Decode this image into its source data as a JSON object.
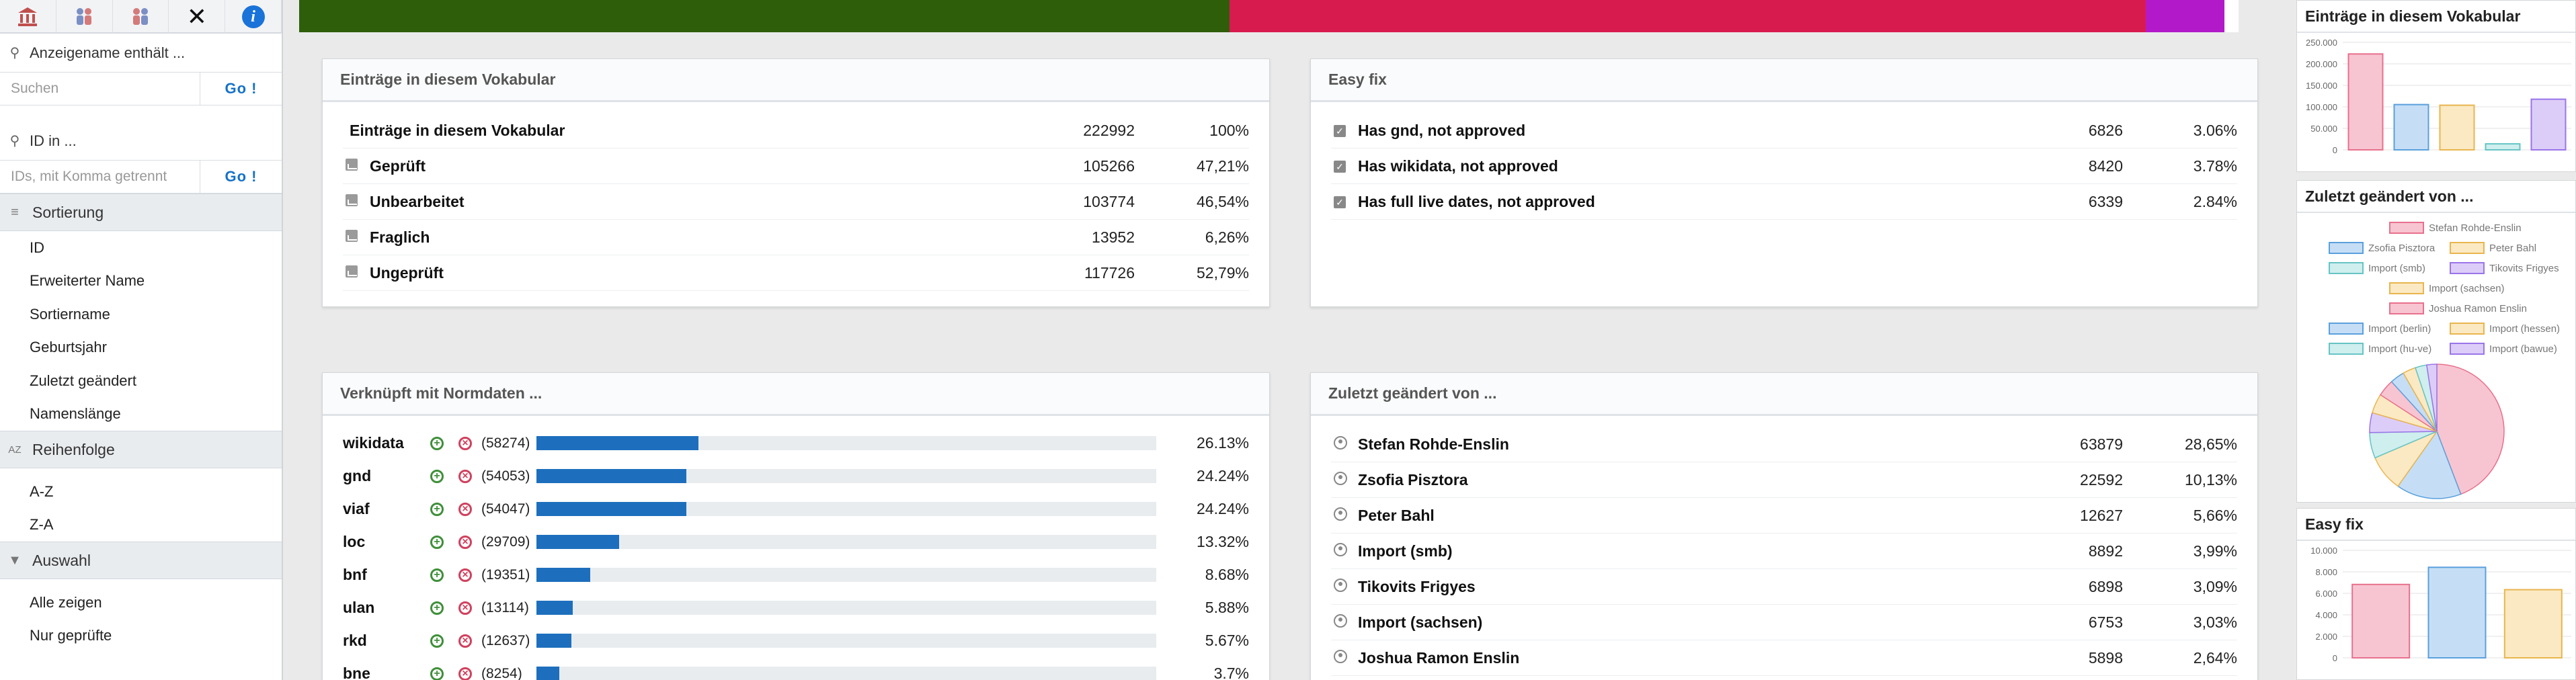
{
  "sidebar": {
    "search_name_label": "Anzeigename enthält ...",
    "search_placeholder": "Suchen",
    "go_label": "Go !",
    "id_label": "ID in ...",
    "id_placeholder": "IDs, mit Komma getrennt",
    "sort_section": "Sortierung",
    "sort_items": [
      "ID",
      "Erweiterter Name",
      "Sortiername",
      "Geburtsjahr",
      "Zuletzt geändert",
      "Namenslänge"
    ],
    "order_section": "Reihenfolge",
    "order_items": [
      "A-Z",
      "Z-A"
    ],
    "filter_section": "Auswahl",
    "filter_items": [
      "Alle zeigen",
      "Nur geprüfte"
    ]
  },
  "topbar": [
    {
      "color": "#2f5e0a",
      "fraction": 0.4798
    },
    {
      "color": "#d81b4f",
      "fraction": 0.4724
    },
    {
      "color": "#b21ac9",
      "fraction": 0.0407
    },
    {
      "color": "#ffffff",
      "fraction": 0.0071
    }
  ],
  "vocab_panel": {
    "title": "Einträge in diesem Vokabular",
    "rows": [
      {
        "label": "Einträge in diesem Vokabular",
        "count": "222992",
        "pct": "100%",
        "icon": "none"
      },
      {
        "label": "Geprüft",
        "count": "105266",
        "pct": "47,21%",
        "icon": "image-icon"
      },
      {
        "label": "Unbearbeitet",
        "count": "103774",
        "pct": "46,54%",
        "icon": "image-icon"
      },
      {
        "label": "Fraglich",
        "count": "13952",
        "pct": "6,26%",
        "icon": "image-icon"
      },
      {
        "label": "Ungeprüft",
        "count": "117726",
        "pct": "52,79%",
        "icon": "image-icon"
      }
    ]
  },
  "easyfix_panel": {
    "title": "Easy fix",
    "rows": [
      {
        "label": "Has gnd, not approved",
        "count": "6826",
        "pct": "3.06%"
      },
      {
        "label": "Has wikidata, not approved",
        "count": "8420",
        "pct": "3.78%"
      },
      {
        "label": "Has full live dates, not approved",
        "count": "6339",
        "pct": "2.84%"
      }
    ]
  },
  "norm_panel": {
    "title": "Verknüpft mit Normdaten ...",
    "rows": [
      {
        "label": "wikidata",
        "count": "(58274)",
        "pct": "26.13%",
        "value": 26.13
      },
      {
        "label": "gnd",
        "count": "(54053)",
        "pct": "24.24%",
        "value": 24.24
      },
      {
        "label": "viaf",
        "count": "(54047)",
        "pct": "24.24%",
        "value": 24.24
      },
      {
        "label": "loc",
        "count": "(29709)",
        "pct": "13.32%",
        "value": 13.32
      },
      {
        "label": "bnf",
        "count": "(19351)",
        "pct": "8.68%",
        "value": 8.68
      },
      {
        "label": "ulan",
        "count": "(13114)",
        "pct": "5.88%",
        "value": 5.88
      },
      {
        "label": "rkd",
        "count": "(12637)",
        "pct": "5.67%",
        "value": 5.67
      },
      {
        "label": "bne",
        "count": "(8254)",
        "pct": "3.7%",
        "value": 3.7
      }
    ]
  },
  "changed_panel": {
    "title": "Zuletzt geändert von ...",
    "rows": [
      {
        "label": "Stefan Rohde-Enslin",
        "count": "63879",
        "pct": "28,65%"
      },
      {
        "label": "Zsofia Pisztora",
        "count": "22592",
        "pct": "10,13%"
      },
      {
        "label": "Peter Bahl",
        "count": "12627",
        "pct": "5,66%"
      },
      {
        "label": "Import (smb)",
        "count": "8892",
        "pct": "3,99%"
      },
      {
        "label": "Tikovits Frigyes",
        "count": "6898",
        "pct": "3,09%"
      },
      {
        "label": "Import (sachsen)",
        "count": "6753",
        "pct": "3,03%"
      },
      {
        "label": "Joshua Ramon Enslin",
        "count": "5898",
        "pct": "2,64%"
      }
    ]
  },
  "mini_vocab": {
    "title": "Einträge in diesem Vokabular",
    "ticks": [
      "250.000",
      "200.000",
      "150.000",
      "100.000",
      "50.000",
      "0"
    ]
  },
  "mini_changed": {
    "title": "Zuletzt geändert von ...",
    "legend": [
      "Stefan Rohde-Enslin",
      "Zsofia Pisztora",
      "Peter Bahl",
      "Import (smb)",
      "Tikovits Frigyes",
      "Import (sachsen)",
      "Joshua Ramon Enslin",
      "Import (berlin)",
      "Import (hessen)",
      "Import (hu-ve)",
      "Import (bawue)"
    ]
  },
  "mini_easyfix": {
    "title": "Easy fix",
    "ticks": [
      "10.000",
      "8.000",
      "6.000",
      "4.000",
      "2.000",
      "0"
    ]
  },
  "chart_data": [
    {
      "type": "bar",
      "title": "Einträge in diesem Vokabular",
      "categories": [
        "Einträge in diesem Vokabular",
        "Geprüft",
        "Unbearbeitet",
        "Fraglich",
        "Ungeprüft"
      ],
      "values": [
        222992,
        105266,
        103774,
        13952,
        117726
      ],
      "ylim": [
        0,
        250000
      ],
      "colors": [
        "#f7c5d1",
        "#c6def5",
        "#fbe9c3",
        "#cfeeee",
        "#dccdf8"
      ],
      "strokes": [
        "#e8708d",
        "#5aa0dd",
        "#e9b54e",
        "#66c4c4",
        "#9a75e8"
      ],
      "grid": true
    },
    {
      "type": "pie",
      "title": "Zuletzt geändert von ...",
      "labels": [
        "Stefan Rohde-Enslin",
        "Zsofia Pisztora",
        "Peter Bahl",
        "Import (smb)",
        "Tikovits Frigyes",
        "Import (sachsen)",
        "Joshua Ramon Enslin",
        "Import (berlin)",
        "Import (hessen)",
        "Import (hu-ve)",
        "Import (bawue)"
      ],
      "values": [
        63879,
        22592,
        12627,
        8892,
        6898,
        6753,
        5898,
        5000,
        4500,
        4000,
        3500
      ],
      "legend": "top",
      "colors": [
        "#f7c5d1",
        "#c6def5",
        "#fbe9c3",
        "#cfeeee",
        "#dccdf8",
        "#fbe9c3",
        "#f7c5d1",
        "#c6def5",
        "#fbe9c3",
        "#cfeeee",
        "#dccdf8"
      ],
      "strokes": [
        "#e8708d",
        "#5aa0dd",
        "#e9b54e",
        "#66c4c4",
        "#9a75e8",
        "#e9b54e",
        "#e8708d",
        "#5aa0dd",
        "#e9b54e",
        "#66c4c4",
        "#9a75e8"
      ]
    },
    {
      "type": "bar",
      "title": "Easy fix",
      "categories": [
        "Has gnd, not approved",
        "Has wikidata, not approved",
        "Has full live dates, not approved"
      ],
      "values": [
        6826,
        8420,
        6339
      ],
      "ylim": [
        0,
        10000
      ],
      "colors": [
        "#f7c5d1",
        "#c6def5",
        "#fbe9c3"
      ],
      "strokes": [
        "#e8708d",
        "#5aa0dd",
        "#e9b54e"
      ],
      "grid": true
    }
  ]
}
